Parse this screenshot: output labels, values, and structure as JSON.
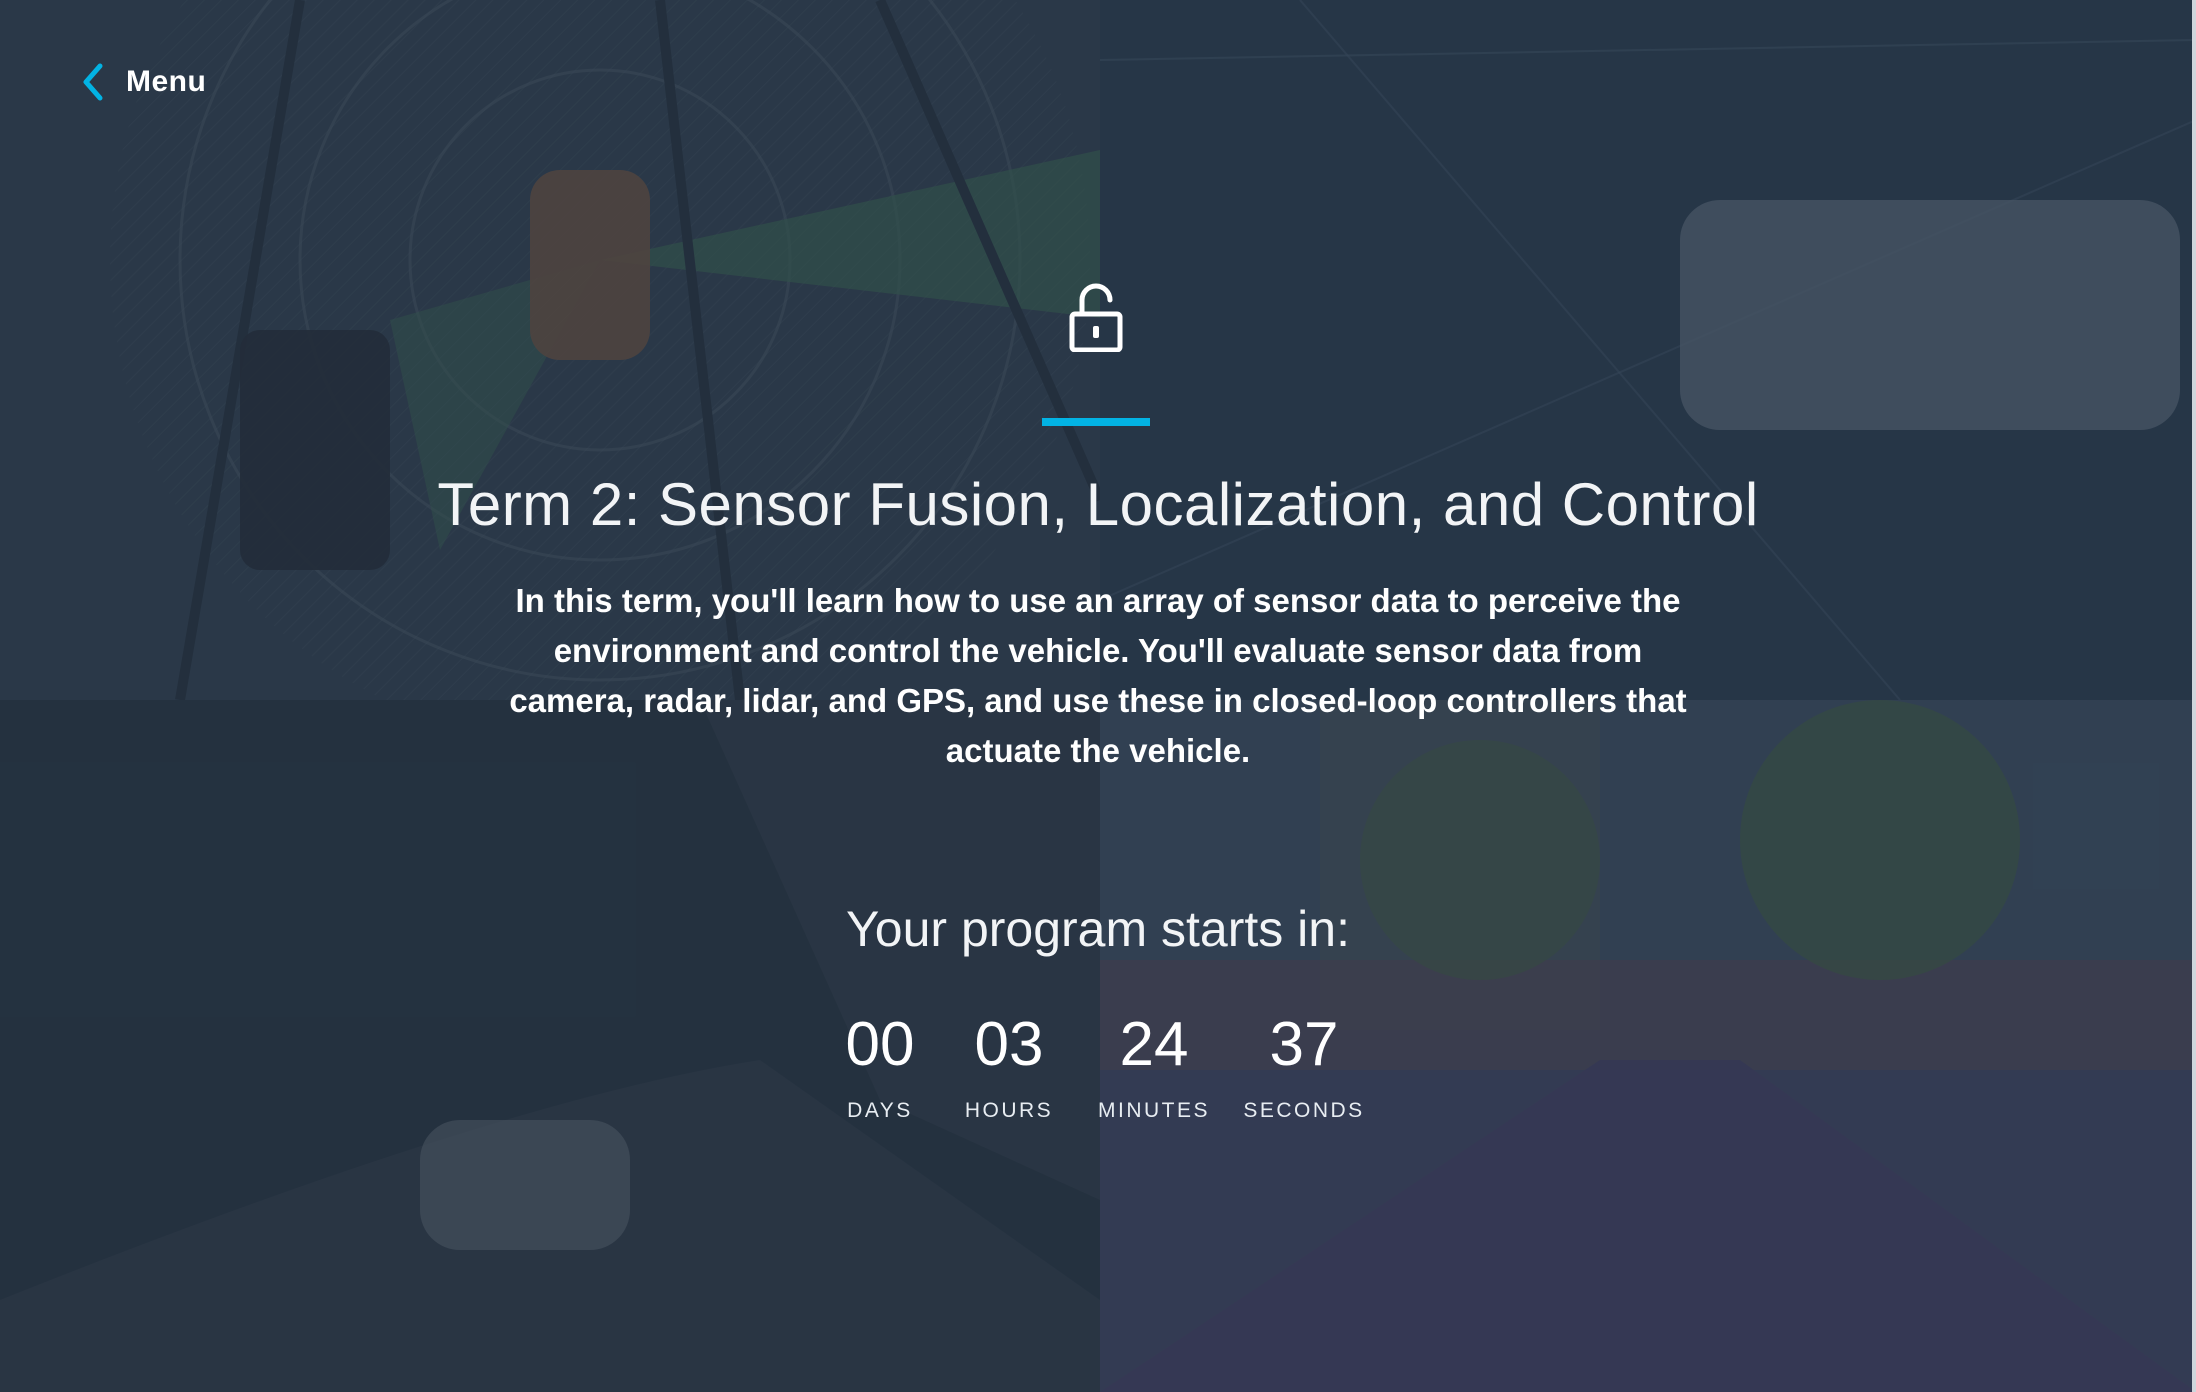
{
  "nav": {
    "menu_label": "Menu",
    "menu_icon": "chevron-left-icon"
  },
  "hero": {
    "icon": "unlocked-padlock-icon",
    "accent_color": "#02b3e4",
    "title": "Term 2: Sensor Fusion, Localization, and Control",
    "description": "In this term, you'll learn how to use an array of sensor data to perceive the environment and control the vehicle. You'll evaluate sensor data from camera, radar, lidar, and GPS, and use these in closed-loop controllers that actuate the vehicle."
  },
  "countdown": {
    "label": "Your program starts in:",
    "days": {
      "value": "00",
      "label": "DAYS"
    },
    "hours": {
      "value": "03",
      "label": "HOURS"
    },
    "minutes": {
      "value": "24",
      "label": "MINUTES"
    },
    "seconds": {
      "value": "37",
      "label": "SECONDS"
    }
  }
}
